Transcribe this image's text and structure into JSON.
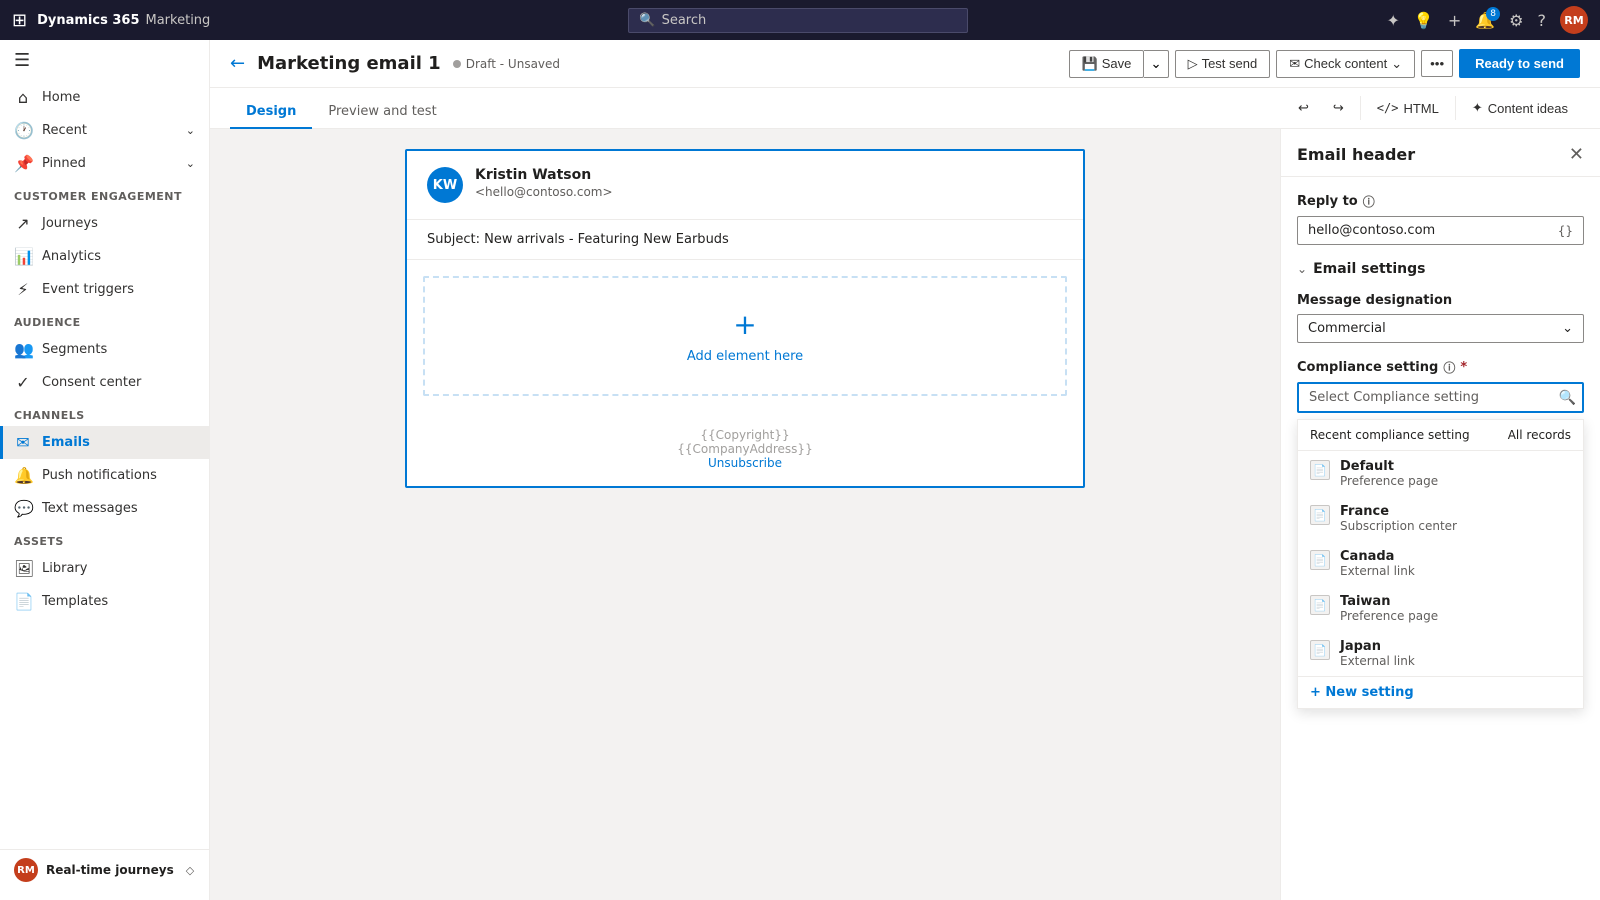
{
  "topnav": {
    "apps_icon": "⊞",
    "brand": "Dynamics 365",
    "module": "Marketing",
    "search_placeholder": "Search",
    "icons": {
      "copilot": "✦",
      "help_tip": "?",
      "plus": "+",
      "bell": "🔔",
      "settings": "⚙",
      "help": "?"
    },
    "notification_count": "8",
    "avatar_initials": "RM"
  },
  "sidebar": {
    "toggle_icon": "☰",
    "nav_items": [
      {
        "id": "home",
        "icon": "⌂",
        "label": "Home"
      },
      {
        "id": "recent",
        "icon": "🕐",
        "label": "Recent",
        "chevron": "⌄"
      },
      {
        "id": "pinned",
        "icon": "📌",
        "label": "Pinned",
        "chevron": "⌄"
      }
    ],
    "sections": [
      {
        "label": "Customer engagement",
        "items": [
          {
            "id": "journeys",
            "icon": "↗",
            "label": "Journeys"
          },
          {
            "id": "analytics",
            "icon": "📊",
            "label": "Analytics"
          },
          {
            "id": "event-triggers",
            "icon": "⚡",
            "label": "Event triggers"
          }
        ]
      },
      {
        "label": "Audience",
        "items": [
          {
            "id": "segments",
            "icon": "👥",
            "label": "Segments"
          },
          {
            "id": "consent-center",
            "icon": "✓",
            "label": "Consent center"
          }
        ]
      },
      {
        "label": "Channels",
        "items": [
          {
            "id": "emails",
            "icon": "✉",
            "label": "Emails",
            "active": true
          },
          {
            "id": "push-notifications",
            "icon": "🔔",
            "label": "Push notifications"
          },
          {
            "id": "text-messages",
            "icon": "💬",
            "label": "Text messages"
          }
        ]
      },
      {
        "label": "Assets",
        "items": [
          {
            "id": "library",
            "icon": "🖼",
            "label": "Library"
          },
          {
            "id": "templates",
            "icon": "📄",
            "label": "Templates"
          }
        ]
      }
    ],
    "footer": {
      "initials": "RM",
      "label": "Real-time journeys",
      "chevron": "◇"
    }
  },
  "page_header": {
    "back_icon": "←",
    "title": "Marketing email 1",
    "status_text": "Draft - Unsaved",
    "actions": {
      "save": "Save",
      "test_send": "Test send",
      "check_content": "Check content",
      "more_icon": "•••",
      "ready_to_send": "Ready to send"
    }
  },
  "tabs": {
    "items": [
      {
        "id": "design",
        "label": "Design",
        "active": true
      },
      {
        "id": "preview-and-test",
        "label": "Preview and test",
        "active": false
      }
    ],
    "toolbar": {
      "undo_icon": "↩",
      "redo_icon": "↪",
      "html_icon": "</>",
      "html_label": "HTML",
      "content_ideas_label": "Content ideas"
    }
  },
  "email_canvas": {
    "sender": {
      "initials": "KW",
      "name": "Kristin Watson",
      "email": "<hello@contoso.com>"
    },
    "subject_prefix": "Subject:",
    "subject": "New arrivals - Featuring New Earbuds",
    "dropzone_label": "Add element here",
    "footer_line1": "{{Copyright}}",
    "footer_line2": "{{CompanyAddress}}",
    "unsubscribe": "Unsubscribe"
  },
  "right_panel": {
    "title": "Email header",
    "close_icon": "✕",
    "reply_to": {
      "label": "Reply to",
      "info_icon": "ⓘ",
      "value": "hello@contoso.com",
      "curly_icon": "{}"
    },
    "email_settings": {
      "section_label": "Email settings",
      "chevron": "⌄",
      "message_designation": {
        "label": "Message designation",
        "value": "Commercial",
        "dropdown_icon": "⌄"
      },
      "compliance_setting": {
        "label": "Compliance setting",
        "info_icon": "ⓘ",
        "required": "*",
        "placeholder": "Select Compliance setting",
        "search_icon": "🔍",
        "dropdown": {
          "recent_label": "Recent compliance setting",
          "all_records": "All records",
          "items": [
            {
              "name": "Default",
              "sub": "Preference page"
            },
            {
              "name": "France",
              "sub": "Subscription center"
            },
            {
              "name": "Canada",
              "sub": "External link"
            },
            {
              "name": "Taiwan",
              "sub": "Preference page"
            },
            {
              "name": "Japan",
              "sub": "External link"
            }
          ],
          "new_setting": "+ New setting"
        }
      }
    }
  }
}
